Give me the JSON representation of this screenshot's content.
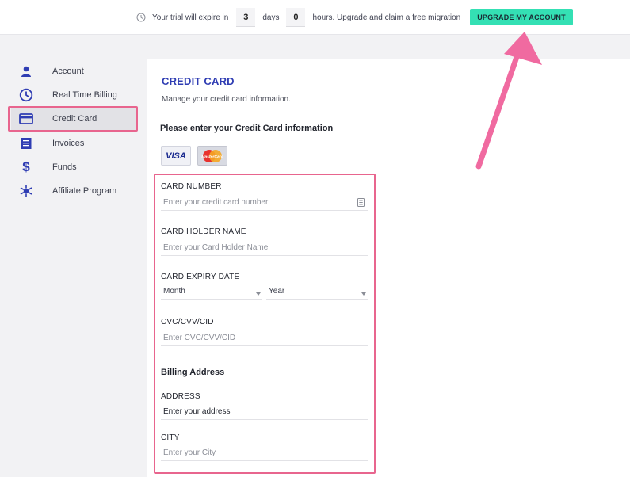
{
  "topbar": {
    "trial_prefix": "Your trial will expire in",
    "days_value": "3",
    "days_label": "days",
    "hours_value": "0",
    "hours_suffix": "hours. Upgrade and claim a free migration",
    "upgrade_label": "UPGRADE MY ACCOUNT"
  },
  "sidebar": {
    "items": [
      {
        "label": "Account",
        "icon": "user-icon"
      },
      {
        "label": "Real Time Billing",
        "icon": "clock-icon"
      },
      {
        "label": "Credit Card",
        "icon": "credit-card-icon"
      },
      {
        "label": "Invoices",
        "icon": "document-icon"
      },
      {
        "label": "Funds",
        "icon": "dollar-icon"
      },
      {
        "label": "Affiliate Program",
        "icon": "network-icon"
      }
    ],
    "active_index": 2
  },
  "main": {
    "title": "CREDIT CARD",
    "subtitle": "Manage your credit card information.",
    "heading": "Please enter your Credit Card information",
    "card_logos": [
      "VISA",
      "MasterCard"
    ],
    "fields": {
      "card_number": {
        "label": "CARD NUMBER",
        "placeholder": "Enter your credit card number"
      },
      "holder_name": {
        "label": "CARD HOLDER NAME",
        "placeholder": "Enter your Card Holder Name"
      },
      "expiry": {
        "label": "CARD EXPIRY DATE",
        "month": "Month",
        "year": "Year"
      },
      "cvc": {
        "label": "CVC/CVV/CID",
        "placeholder": "Enter CVC/CVV/CID"
      }
    },
    "billing_heading": "Billing Address",
    "billing": {
      "address": {
        "label": "ADDRESS",
        "value": "Enter your address"
      },
      "city": {
        "label": "CITY",
        "placeholder": "Enter your City"
      }
    }
  },
  "colors": {
    "accent_blue": "#2f3db3",
    "upgrade_green": "#34e0b4",
    "highlight_pink": "#e8658e"
  }
}
